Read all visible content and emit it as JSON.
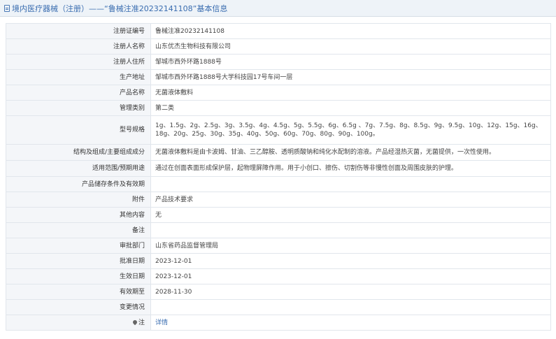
{
  "header": {
    "title": "境内医疗器械（注册）——“鲁械注准20232141108”基本信息"
  },
  "rows": [
    {
      "label": "注册证编号",
      "value": "鲁械注准20232141108"
    },
    {
      "label": "注册人名称",
      "value": "山东优杰生物科技有限公司"
    },
    {
      "label": "注册人住所",
      "value": "邹城市西外环路1888号"
    },
    {
      "label": "生产地址",
      "value": "邹城市西外环路1888号大学科技园17号车间一层"
    },
    {
      "label": "产品名称",
      "value": "无菌液体敷料"
    },
    {
      "label": "管理类别",
      "value": "第二类"
    },
    {
      "label": "型号规格",
      "value": "1g、1.5g、2g、2.5g、3g、3.5g、4g、4.5g、5g、5.5g、6g、6.5g 、7g、7.5g、8g、8.5g、9g、9.5g、10g、12g、15g、16g、18g、20g、25g、30g、35g、40g、50g、60g、70g、80g、90g、100g。"
    },
    {
      "label": "结构及组成/主要组成成分",
      "value": "无菌液体敷料是由卡波姆、甘油、三乙醇胺、透明质酸钠和纯化水配制的溶液。产品经湿热灭菌，无菌提供，一次性使用。"
    },
    {
      "label": "适用范围/预期用途",
      "value": "通过在创面表面形成保护层，起物理屏障作用。用于小创口、擦伤、切割伤等非慢性创面及周围皮肤的护理。"
    },
    {
      "label": "产品储存条件及有效期",
      "value": ""
    },
    {
      "label": "附件",
      "value": "产品技术要求"
    },
    {
      "label": "其他内容",
      "value": "无"
    },
    {
      "label": "备注",
      "value": ""
    },
    {
      "label": "审批部门",
      "value": "山东省药品监督管理局"
    },
    {
      "label": "批准日期",
      "value": "2023-12-01"
    },
    {
      "label": "生效日期",
      "value": "2023-12-01"
    },
    {
      "label": "有效期至",
      "value": "2028-11-30"
    },
    {
      "label": "变更情况",
      "value": ""
    },
    {
      "label": "注",
      "value": "详情"
    }
  ]
}
